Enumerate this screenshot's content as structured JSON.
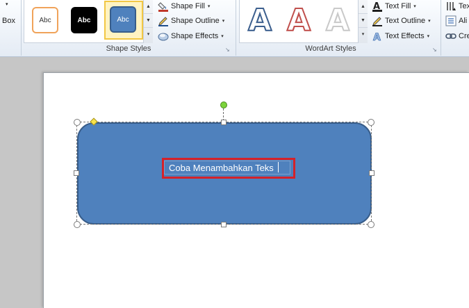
{
  "ribbon": {
    "insert_commands": {
      "first_arrow": "▾",
      "box_label": "Box"
    },
    "shape_styles": {
      "label": "Shape Styles",
      "swatches": [
        "Abc",
        "Abc",
        "Abc"
      ],
      "commands": [
        {
          "label": "Shape Fill",
          "icon": "paint-bucket-icon"
        },
        {
          "label": "Shape Outline",
          "icon": "pencil-outline-icon"
        },
        {
          "label": "Shape Effects",
          "icon": "shape-effects-icon"
        }
      ]
    },
    "wordart_styles": {
      "label": "WordArt Styles",
      "letters": [
        "A",
        "A",
        "A"
      ],
      "commands": [
        {
          "label": "Text Fill",
          "icon": "text-fill-icon"
        },
        {
          "label": "Text Outline",
          "icon": "text-outline-icon"
        },
        {
          "label": "Text Effects",
          "icon": "text-effects-icon"
        }
      ]
    },
    "text_group": {
      "commands": [
        {
          "label": "Tex",
          "icon": "text-direction-icon"
        },
        {
          "label": "Ali",
          "icon": "align-text-icon"
        },
        {
          "label": "Cre",
          "icon": "create-link-icon"
        }
      ]
    },
    "launcher_glyph": "↘"
  },
  "document": {
    "shape_text": "Coba Menambahkan Teks",
    "colors": {
      "shape_fill": "#4f81bd",
      "shape_border": "#385d8a",
      "highlight_box": "#d4222a",
      "rotation_handle": "#7bd33b",
      "adjust_handle": "#f8e34c"
    }
  }
}
